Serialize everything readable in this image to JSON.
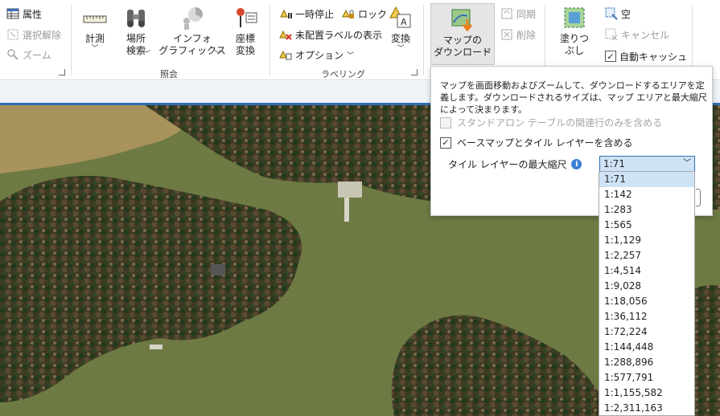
{
  "ribbon": {
    "group1": {
      "attributes_label": "属性",
      "clear_selection_label": "選択解除",
      "zoom_label": "ズーム"
    },
    "inquiry": {
      "group_label": "照会",
      "measure_label": "計測",
      "locate_label": "場所\n検索",
      "infographics_label": "インフォ\nグラフィックス",
      "coordinate_conversion_label": "座標\n変換"
    },
    "labeling": {
      "group_label": "ラベリング",
      "pause_label": "一時停止",
      "lock_label": "ロック",
      "unplaced_labels_label": "未配置ラベルの表示",
      "options_label": "オプション",
      "convert_label": "変換"
    },
    "offline": {
      "download_map_label": "マップの\nダウンロード",
      "sync_label": "同期",
      "remove_label": "削除"
    },
    "cache": {
      "fill_label": "塗りつぶし",
      "empty_label": "空",
      "cancel_label": "キャンセル",
      "auto_cache_label": "自動キャッシュ"
    }
  },
  "download_popup": {
    "description": "マップを画面移動およびズームして、ダウンロードするエリアを定義します。ダウンロードされるサイズは、マップ エリアと最大縮尺によって決まります。",
    "standalone_option_label": "スタンドアロン テーブルの関連行のみを含める",
    "basemap_option_label": "ベースマップとタイル レイヤーを含める",
    "max_scale_label": "タイル レイヤーの最大縮尺",
    "selected_scale": "1:71",
    "scale_options": [
      "1:71",
      "1:142",
      "1:283",
      "1:565",
      "1:1,129",
      "1:2,257",
      "1:4,514",
      "1:9,028",
      "1:18,056",
      "1:36,112",
      "1:72,224",
      "1:144,448",
      "1:288,896",
      "1:577,791",
      "1:1,155,582",
      "1:2,311,163"
    ]
  },
  "colors": {
    "accent": "#2f6fb5",
    "selection": "#cfe3f6",
    "lake_water": "#6e7a43",
    "muddy_water": "#a8935c"
  }
}
